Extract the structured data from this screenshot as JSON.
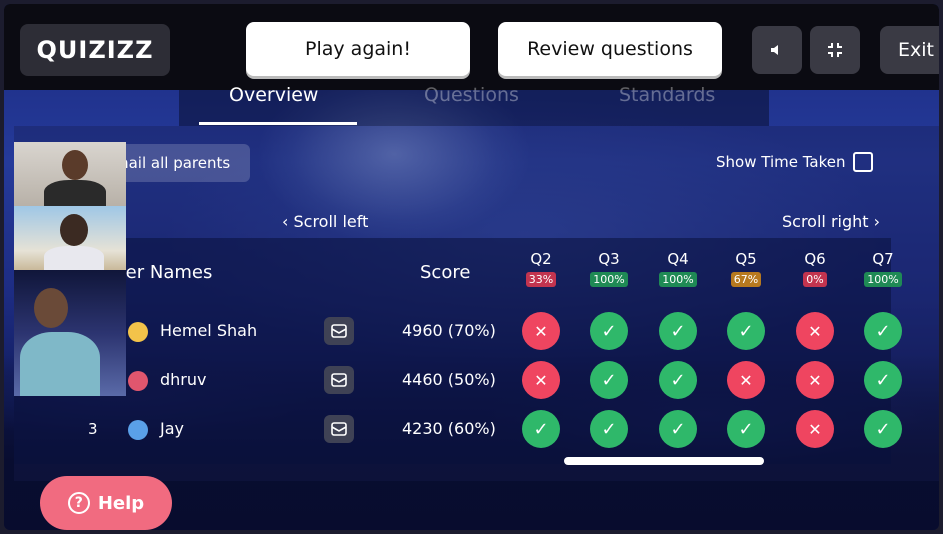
{
  "app": {
    "logo_text": "QUIZIZZ",
    "play_again_label": "Play again!",
    "review_label": "Review questions",
    "exit_label": "Exit"
  },
  "tabs": [
    {
      "label": "Overview",
      "active": true
    },
    {
      "label": "Questions",
      "active": false
    },
    {
      "label": "Standards",
      "active": false
    }
  ],
  "toolbar": {
    "email_parents_label": "mail all parents",
    "show_time_label": "Show Time Taken",
    "scroll_left_label": "Scroll left",
    "scroll_right_label": "Scroll right"
  },
  "table": {
    "col_names": "ayer Names",
    "col_score": "Score",
    "questions": [
      {
        "label": "Q2",
        "pct": "33%",
        "color": "#c2344f"
      },
      {
        "label": "Q3",
        "pct": "100%",
        "color": "#1f8a55"
      },
      {
        "label": "Q4",
        "pct": "100%",
        "color": "#1f8a55"
      },
      {
        "label": "Q5",
        "pct": "67%",
        "color": "#b7791f"
      },
      {
        "label": "Q6",
        "pct": "0%",
        "color": "#c2344f"
      },
      {
        "label": "Q7",
        "pct": "100%",
        "color": "#1f8a55"
      }
    ],
    "rows": [
      {
        "rank": "",
        "name": "Hemel Shah",
        "score": "4960 (70%)",
        "avatar_color": "#f3c34a",
        "answers": [
          "wrong",
          "correct",
          "correct",
          "correct",
          "wrong",
          "correct"
        ]
      },
      {
        "rank": "",
        "name": "dhruv",
        "score": "4460 (50%)",
        "avatar_color": "#e0566e",
        "answers": [
          "wrong",
          "correct",
          "correct",
          "wrong",
          "wrong",
          "correct"
        ]
      },
      {
        "rank": "3",
        "name": "Jay",
        "score": "4230 (60%)",
        "avatar_color": "#5aa0e8",
        "answers": [
          "correct",
          "correct",
          "correct",
          "correct",
          "wrong",
          "correct"
        ]
      }
    ],
    "scrollbar_position": 0.12
  },
  "help": {
    "label": "Help",
    "icon": "question-icon"
  }
}
